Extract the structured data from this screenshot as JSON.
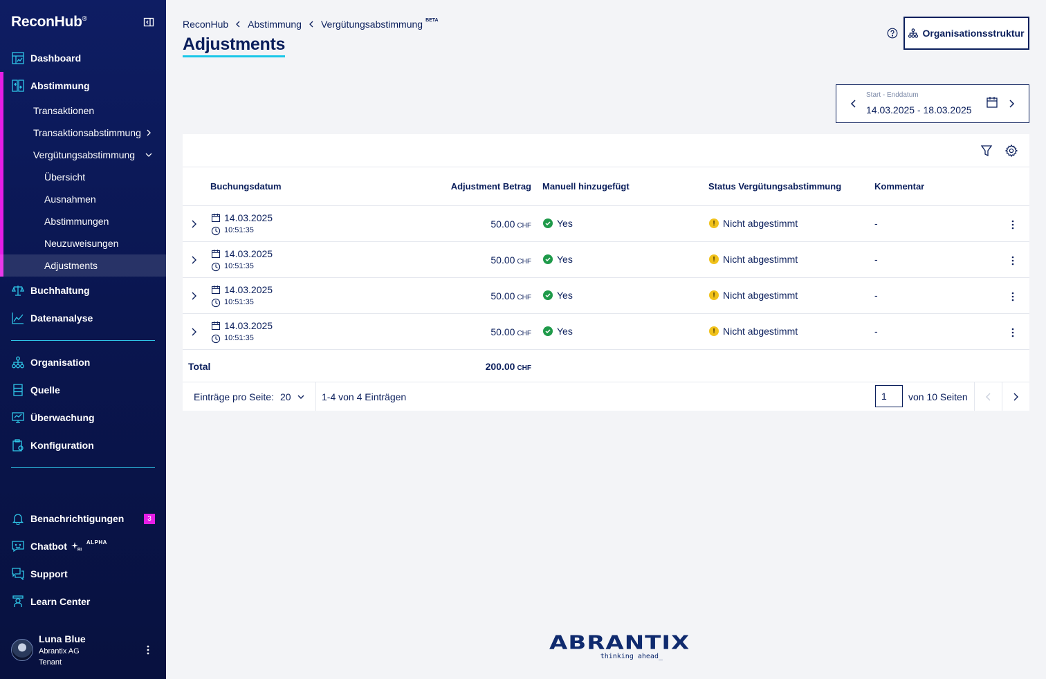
{
  "sidebar": {
    "brand": "ReconHub",
    "brand_mark": "®",
    "nav": {
      "dashboard": "Dashboard",
      "abstimmung": "Abstimmung",
      "transaktionen": "Transaktionen",
      "transaktionsabstimmung": "Transaktionsabstimmung",
      "verguetungsabstimmung": "Vergütungsabstimmung",
      "uebersicht": "Übersicht",
      "ausnahmen": "Ausnahmen",
      "abstimmungen": "Abstimmungen",
      "neuzuweisungen": "Neuzuweisungen",
      "adjustments": "Adjustments",
      "buchhaltung": "Buchhaltung",
      "datenanalyse": "Datenanalyse",
      "organisation": "Organisation",
      "quelle": "Quelle",
      "ueberwachung": "Überwachung",
      "konfiguration": "Konfiguration",
      "benachrichtigungen": "Benachrichtigungen",
      "chatbot": "Chatbot",
      "chatbot_tag": "ALPHA",
      "support": "Support",
      "learn_center": "Learn Center"
    },
    "notifications_count": "3",
    "user": {
      "name": "Luna Blue",
      "org": "Abrantix AG",
      "role": "Tenant"
    },
    "accent_color": "#e61ee6",
    "divider_color": "#2fc6e8"
  },
  "header": {
    "breadcrumb": [
      "ReconHub",
      "Abstimmung",
      "Vergütungsabstimmung"
    ],
    "breadcrumb_tag": "BETA",
    "title": "Adjustments",
    "org_button": "Organisationsstruktur"
  },
  "datepicker": {
    "label": "Start - Enddatum",
    "value": "14.03.2025 - 18.03.2025"
  },
  "table": {
    "columns": {
      "date": "Buchungsdatum",
      "amount": "Adjustment Betrag",
      "manual": "Manuell hinzugefügt",
      "status": "Status Vergütungsabstimmung",
      "comment": "Kommentar"
    },
    "rows": [
      {
        "date": "14.03.2025",
        "time": "10:51:35",
        "amount": "50.00",
        "currency": "CHF",
        "manual": "Yes",
        "status": "Nicht abgestimmt",
        "comment": "-"
      },
      {
        "date": "14.03.2025",
        "time": "10:51:35",
        "amount": "50.00",
        "currency": "CHF",
        "manual": "Yes",
        "status": "Nicht abgestimmt",
        "comment": "-"
      },
      {
        "date": "14.03.2025",
        "time": "10:51:35",
        "amount": "50.00",
        "currency": "CHF",
        "manual": "Yes",
        "status": "Nicht abgestimmt",
        "comment": "-"
      },
      {
        "date": "14.03.2025",
        "time": "10:51:35",
        "amount": "50.00",
        "currency": "CHF",
        "manual": "Yes",
        "status": "Nicht abgestimmt",
        "comment": "-"
      }
    ],
    "total_label": "Total",
    "total_amount": "200.00",
    "total_currency": "CHF",
    "status_colors": {
      "yes": "#1f9a4a",
      "warning": "#f1c21b"
    }
  },
  "pagination": {
    "per_page_label": "Einträge pro Seite:",
    "per_page_value": "20",
    "range": "1-4 von 4 Einträgen",
    "current_page": "1",
    "of_pages": "von 10 Seiten"
  },
  "footer": {
    "logo": "abrantix",
    "tagline": "thinking ahead_"
  }
}
